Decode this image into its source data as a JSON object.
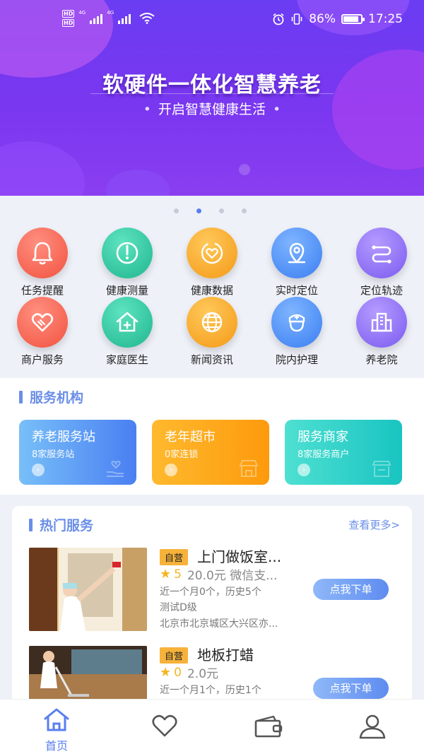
{
  "status_bar": {
    "network_badges": [
      "HD",
      "HD"
    ],
    "signal_labels": [
      "4G",
      "4G"
    ],
    "battery": "86%",
    "time": "17:25"
  },
  "banner": {
    "title": "软硬件一体化智慧养老",
    "subtitle": "开启智慧健康生活",
    "page_count": 4,
    "active_page": 2
  },
  "grid": [
    {
      "label": "任务提醒",
      "icon": "bell-icon",
      "color": "red"
    },
    {
      "label": "健康测量",
      "icon": "gauge-icon",
      "color": "green"
    },
    {
      "label": "健康数据",
      "icon": "heart-data-icon",
      "color": "orange"
    },
    {
      "label": "实时定位",
      "icon": "location-pin-icon",
      "color": "blue"
    },
    {
      "label": "定位轨迹",
      "icon": "track-icon",
      "color": "purple"
    },
    {
      "label": "商户服务",
      "icon": "handshake-heart-icon",
      "color": "red"
    },
    {
      "label": "家庭医生",
      "icon": "home-medical-icon",
      "color": "green"
    },
    {
      "label": "新闻资讯",
      "icon": "globe-icon",
      "color": "orange"
    },
    {
      "label": "院内护理",
      "icon": "nurse-icon",
      "color": "blue"
    },
    {
      "label": "养老院",
      "icon": "building-icon",
      "color": "purple"
    }
  ],
  "institutions": {
    "title": "服务机构",
    "cards": [
      {
        "title": "养老服务站",
        "sub": "8家服务站"
      },
      {
        "title": "老年超市",
        "sub": "0家连锁"
      },
      {
        "title": "服务商家",
        "sub": "8家服务商户"
      }
    ]
  },
  "hot": {
    "title": "热门服务",
    "more": "查看更多>",
    "items": [
      {
        "tag": "自营",
        "name": "上门做饭室...",
        "rating": "5",
        "price_info": "20.0元 微信支...",
        "sales": "近一个月0个，历史5个",
        "level": "测试D级",
        "address": "北京市北京城区大兴区亦...",
        "order": "点我下单"
      },
      {
        "tag": "自营",
        "name": "地板打蜡",
        "rating": "0",
        "price_info": "2.0元",
        "sales": "近一个月1个，历史1个",
        "order": "点我下单"
      }
    ]
  },
  "tabbar": {
    "tabs": [
      {
        "icon": "home-icon",
        "label": "首页",
        "active": true
      },
      {
        "icon": "heart-icon",
        "active": false
      },
      {
        "icon": "wallet-icon",
        "active": false
      },
      {
        "icon": "user-icon",
        "active": false
      }
    ]
  }
}
